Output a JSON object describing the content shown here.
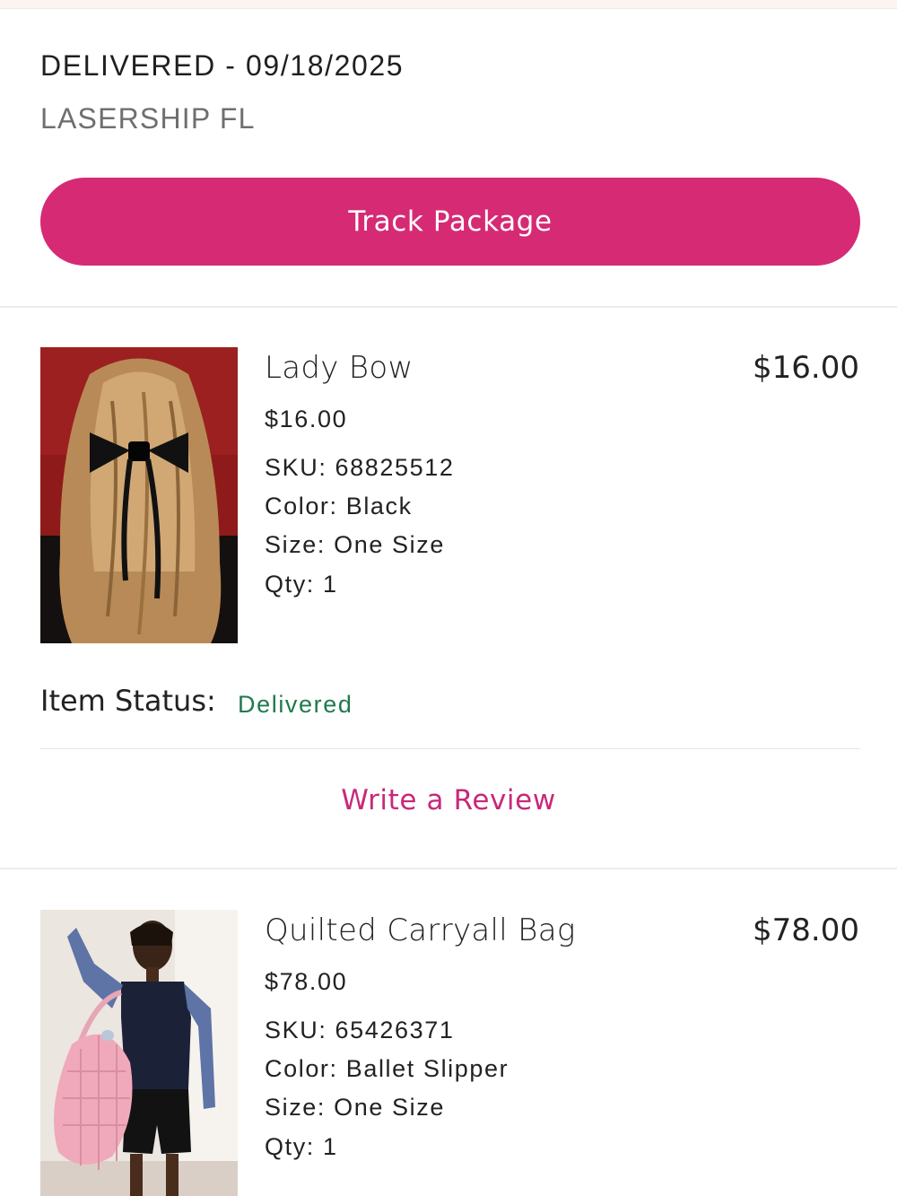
{
  "shipment": {
    "status": "DELIVERED - 09/18/2025",
    "carrier": "LASERSHIP FL",
    "track_button_label": "Track Package"
  },
  "items": [
    {
      "name": "Lady Bow",
      "total": "$16.00",
      "price": "$16.00",
      "sku": "SKU: 68825512",
      "color": "Color: Black",
      "size": "Size: One Size",
      "qty": "Qty: 1",
      "status_label": "Item Status:",
      "status_value": "Delivered",
      "review_label": "Write a Review"
    },
    {
      "name": "Quilted Carryall Bag",
      "total": "$78.00",
      "price": "$78.00",
      "sku": "SKU: 65426371",
      "color": "Color: Ballet Slipper",
      "size": "Size: One Size",
      "qty": "Qty: 1"
    }
  ],
  "colors": {
    "accent": "#d62a75",
    "status_delivered": "#1f7a4c",
    "link": "#c8297a"
  }
}
